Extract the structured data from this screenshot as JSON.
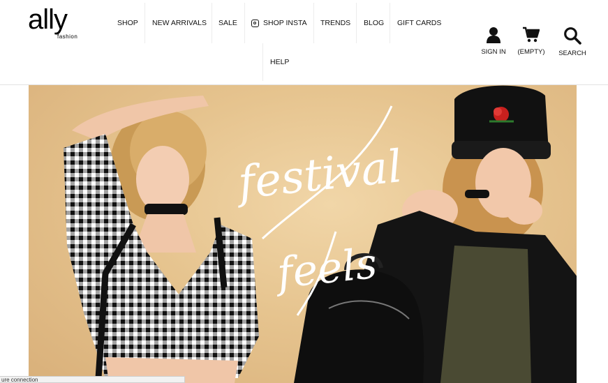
{
  "brand": {
    "logo_text": "ally",
    "logo_subtext": "fashion"
  },
  "nav": {
    "items": [
      "SHOP",
      "NEW ARRIVALS",
      "SALE",
      "SHOP INSTA",
      "TRENDS",
      "BLOG",
      "GIFT CARDS"
    ],
    "help": "HELP"
  },
  "utility": {
    "sign_in": "SIGN IN",
    "cart": "(EMPTY)",
    "search": "SEARCH"
  },
  "hero": {
    "headline_line1": "festival",
    "headline_line2": "feels"
  },
  "status_bar": {
    "text": "ure connection"
  },
  "colors": {
    "hero_background": "#e6c896",
    "text": "#111111"
  }
}
